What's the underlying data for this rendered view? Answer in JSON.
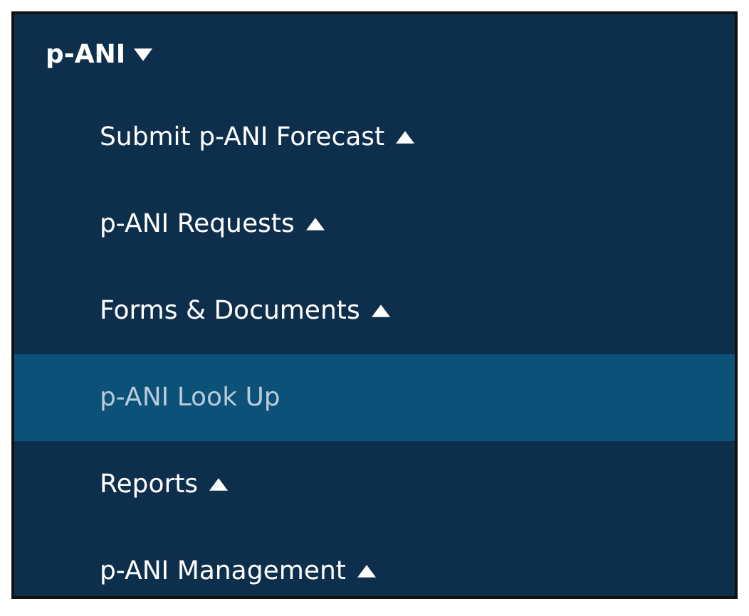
{
  "menu": {
    "label": "p-ANI",
    "expanded": true,
    "items": [
      {
        "label": "Submit p-ANI Forecast",
        "kind": "group",
        "expanded": false,
        "selected": false
      },
      {
        "label": "p-ANI Requests",
        "kind": "group",
        "expanded": false,
        "selected": false
      },
      {
        "label": "Forms & Documents",
        "kind": "group",
        "expanded": false,
        "selected": false
      },
      {
        "label": "p-ANI Look Up",
        "kind": "link",
        "selected": true
      },
      {
        "label": "Reports",
        "kind": "group",
        "expanded": false,
        "selected": false
      },
      {
        "label": "p-ANI Management",
        "kind": "group",
        "expanded": false,
        "selected": false
      }
    ]
  }
}
